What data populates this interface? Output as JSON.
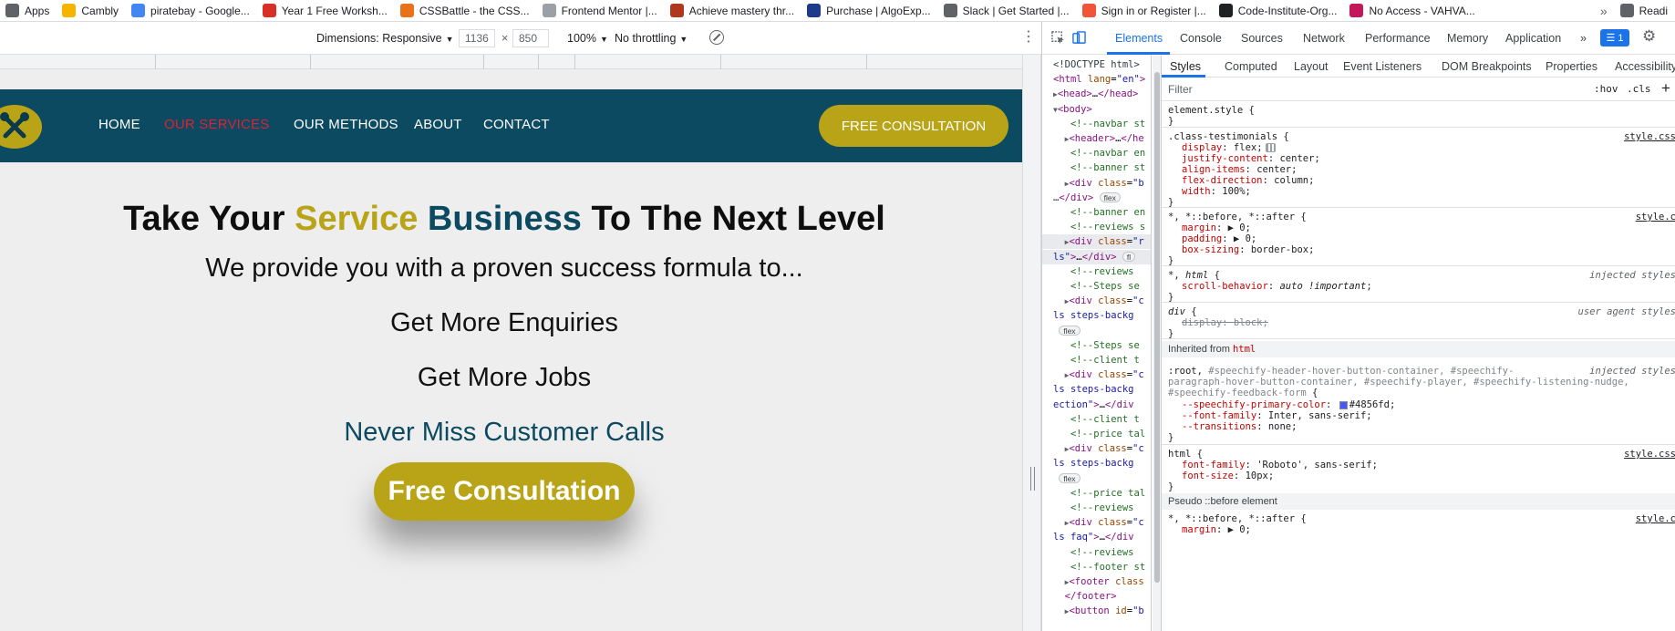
{
  "bookmarks": {
    "items": [
      {
        "label": "Apps",
        "icon": "apps-grid-icon",
        "color": "#5f6368"
      },
      {
        "label": "Cambly",
        "icon": "cambly-icon",
        "color": "#f4b400"
      },
      {
        "label": "piratebay - Google...",
        "icon": "google-icon",
        "color": "#4285f4"
      },
      {
        "label": "Year 1 Free Worksh...",
        "icon": "flag-icon",
        "color": "#d93025"
      },
      {
        "label": "CSSBattle - the CSS...",
        "icon": "cssbattle-icon",
        "color": "#e8711a"
      },
      {
        "label": "Frontend Mentor |...",
        "icon": "blank-page-icon",
        "color": "#9aa0a6"
      },
      {
        "label": "Achieve mastery thr...",
        "icon": "codewars-icon",
        "color": "#b1361e"
      },
      {
        "label": "Purchase | AlgoExp...",
        "icon": "algoexpert-icon",
        "color": "#1e3a8a"
      },
      {
        "label": "Slack | Get Started |...",
        "icon": "globe-icon",
        "color": "#5f6368"
      },
      {
        "label": "Sign in or Register |...",
        "icon": "eventbrite-icon",
        "color": "#f05537"
      },
      {
        "label": "Code-Institute-Org...",
        "icon": "github-icon",
        "color": "#202124"
      },
      {
        "label": "No Access - VAHVA...",
        "icon": "vahva-icon",
        "color": "#c2185b"
      }
    ],
    "more": "»",
    "trailing_label": "Readi"
  },
  "device_toolbar": {
    "dimensions_label": "Dimensions: Responsive",
    "width": "1136",
    "times": "×",
    "height": "850",
    "zoom": "100%",
    "throttling": "No throttling"
  },
  "site": {
    "nav": {
      "links": [
        "HOME",
        "OUR SERVICES",
        "OUR METHODS",
        "ABOUT",
        "CONTACT"
      ],
      "active_index": 1,
      "cta": "FREE CONSULTATION"
    },
    "hero": {
      "title_part1": "Take Your ",
      "title_gold": "Service",
      "title_space": " ",
      "title_teal": "Business",
      "title_part2": " To The Next Level",
      "subtitle": "We provide you with a proven success formula to...",
      "points": [
        "Get More Enquiries",
        "Get More Jobs",
        "Never Miss Customer Calls"
      ],
      "cta": "Free Consultation"
    },
    "colors": {
      "navbar": "#0b4a60",
      "accent_gold": "#b9a418",
      "active_link": "#e21f35",
      "background": "#eeeeee"
    }
  },
  "devtools": {
    "tabs": [
      "Elements",
      "Console",
      "Sources",
      "Network",
      "Performance",
      "Memory",
      "Application"
    ],
    "active_tab": "Elements",
    "more_tabs": "»",
    "issues_badge": "1",
    "dom_lines": [
      {
        "html": "<span class=\"txt\">&lt;!DOCTYPE html&gt;</span>"
      },
      {
        "html": "<span class=\"tag\">&lt;html</span> <span class=\"attr\">lang</span>=<span class=\"aval\">\"en\"</span><span class=\"tag\">&gt;</span>"
      },
      {
        "html": "<span class=\"tri\">▶</span><span class=\"tag\">&lt;head&gt;</span>…<span class=\"tag\">&lt;/head&gt;</span>"
      },
      {
        "html": "<span class=\"tri\">▼</span><span class=\"tag\">&lt;body&gt;</span>"
      },
      {
        "html": "&nbsp;&nbsp;&nbsp;<span class=\"cmt\">&lt;!--navbar st</span>"
      },
      {
        "html": "&nbsp;&nbsp;<span class=\"tri\">▶</span><span class=\"tag\">&lt;header&gt;</span>…<span class=\"tag\">&lt;/he</span>"
      },
      {
        "html": "&nbsp;&nbsp;&nbsp;<span class=\"cmt\">&lt;!--navbar en</span>"
      },
      {
        "html": "&nbsp;&nbsp;&nbsp;<span class=\"cmt\">&lt;!--banner st</span>"
      },
      {
        "html": "&nbsp;&nbsp;<span class=\"tri\">▶</span><span class=\"tag\">&lt;div</span> <span class=\"attr\">class</span>=<span class=\"aval\">\"b</span>"
      },
      {
        "html": "<span class=\"txt\">…</span><span class=\"tag\">&lt;/div&gt;</span> <span class=\"pill\">flex</span>"
      },
      {
        "html": "&nbsp;&nbsp;&nbsp;<span class=\"cmt\">&lt;!--banner en</span>"
      },
      {
        "html": "&nbsp;&nbsp;&nbsp;<span class=\"cmt\">&lt;!--reviews s</span>"
      },
      {
        "html": "&nbsp;&nbsp;<span class=\"tri\">▶</span><span class=\"tag\">&lt;div</span> <span class=\"attr\">class</span>=<span class=\"aval\">\"r</span>",
        "selected": true
      },
      {
        "html": "<span class=\"aval\">ls\"</span><span class=\"tag\">&gt;</span>…<span class=\"tag\">&lt;/div&gt;</span> <span class=\"pill\">fl</span>",
        "selected": true
      },
      {
        "html": "&nbsp;&nbsp;&nbsp;<span class=\"cmt\">&lt;!--reviews</span>"
      },
      {
        "html": "&nbsp;&nbsp;&nbsp;<span class=\"cmt\">&lt;!--Steps se</span>"
      },
      {
        "html": "&nbsp;&nbsp;<span class=\"tri\">▶</span><span class=\"tag\">&lt;div</span> <span class=\"attr\">class</span>=<span class=\"aval\">\"c</span>"
      },
      {
        "html": "<span class=\"aval\">ls steps-backg</span>"
      },
      {
        "html": "&nbsp;<span class=\"pill\">flex</span>"
      },
      {
        "html": "&nbsp;&nbsp;&nbsp;<span class=\"cmt\">&lt;!--Steps se</span>"
      },
      {
        "html": "&nbsp;&nbsp;&nbsp;<span class=\"cmt\">&lt;!--client t</span>"
      },
      {
        "html": "&nbsp;&nbsp;<span class=\"tri\">▶</span><span class=\"tag\">&lt;div</span> <span class=\"attr\">class</span>=<span class=\"aval\">\"c</span>"
      },
      {
        "html": "<span class=\"aval\">ls steps-backg</span>"
      },
      {
        "html": "<span class=\"aval\">ection\"</span><span class=\"tag\">&gt;</span>…<span class=\"tag\">&lt;/div</span>"
      },
      {
        "html": "&nbsp;&nbsp;&nbsp;<span class=\"cmt\">&lt;!--client t</span>"
      },
      {
        "html": "&nbsp;&nbsp;&nbsp;<span class=\"cmt\">&lt;!--price tal</span>"
      },
      {
        "html": "&nbsp;&nbsp;<span class=\"tri\">▶</span><span class=\"tag\">&lt;div</span> <span class=\"attr\">class</span>=<span class=\"aval\">\"c</span>"
      },
      {
        "html": "<span class=\"aval\">ls steps-backg</span>"
      },
      {
        "html": "&nbsp;<span class=\"pill\">flex</span>"
      },
      {
        "html": "&nbsp;&nbsp;&nbsp;<span class=\"cmt\">&lt;!--price tal</span>"
      },
      {
        "html": "&nbsp;&nbsp;&nbsp;<span class=\"cmt\">&lt;!--reviews</span>"
      },
      {
        "html": "&nbsp;&nbsp;<span class=\"tri\">▶</span><span class=\"tag\">&lt;div</span> <span class=\"attr\">class</span>=<span class=\"aval\">\"c</span>"
      },
      {
        "html": "<span class=\"aval\">ls faq\"</span><span class=\"tag\">&gt;</span>…<span class=\"tag\">&lt;/div</span>"
      },
      {
        "html": "&nbsp;&nbsp;&nbsp;<span class=\"cmt\">&lt;!--reviews</span>"
      },
      {
        "html": "&nbsp;&nbsp;&nbsp;<span class=\"cmt\">&lt;!--footer st</span>"
      },
      {
        "html": "&nbsp;&nbsp;<span class=\"tri\">▶</span><span class=\"tag\">&lt;footer</span> <span class=\"attr\">class</span>"
      },
      {
        "html": "&nbsp;&nbsp;<span class=\"tag\">&lt;/footer&gt;</span>"
      },
      {
        "html": "&nbsp;&nbsp;<span class=\"tri\">▶</span><span class=\"tag\">&lt;button</span> <span class=\"attr\">id</span>=<span class=\"aval\">\"b</span>"
      }
    ],
    "styles_tabs": [
      "Styles",
      "Computed",
      "Layout",
      "Event Listeners",
      "DOM Breakpoints",
      "Properties",
      "Accessibility"
    ],
    "filter_placeholder": "Filter",
    "hov": ":hov",
    "cls": ".cls",
    "plus": "+",
    "inherited_label": "Inherited from",
    "inherited_tag": "html",
    "pseudo_label": "Pseudo ::before element",
    "rules_html": [
      "<span class=\"sel-text\">element.style</span> {",
      "}",
      "<span class=\"sel-text\">.class-testimonials</span> {",
      "<span class=\"prop\">display</span>: <span class=\"val\">flex;</span><span class=\"flexicon\"></span>",
      "<span class=\"prop\">justify-content</span>: <span class=\"val\">center;</span>",
      "<span class=\"prop\">align-items</span>: <span class=\"val\">center;</span>",
      "<span class=\"prop\">flex-direction</span>: <span class=\"val\">column;</span>",
      "<span class=\"prop\">width</span>: <span class=\"val\">100%;</span>",
      "}",
      "<span class=\"sel-text\">*, *::before, *::after</span> {",
      "<span class=\"prop\">margin</span>: <span class=\"val\">▶ 0;</span>",
      "<span class=\"prop\">padding</span>: <span class=\"val\">▶ 0;</span>",
      "<span class=\"prop\">box-sizing</span>: <span class=\"val\">border-box;</span>",
      "}",
      "<span class=\"sel-text\">*, <i>html</i></span> {",
      "<span class=\"prop\">scroll-behavior</span>: <span class=\"val\"><i>auto !important</i>;</span>",
      "}",
      "<span class=\"sel-text\"><i>div</i></span> {",
      "<span class=\"strike\">display: block;</span>",
      "}",
      "<span class=\"sel-text\">:root, <span class=\"sel-dim\">#speechify-header-hover-button-container, #speechify-</span></span>",
      "<span class=\"sel-dim\">paragraph-hover-button-container, #speechify-player, #speechify-listening-nudge,</span>",
      "<span class=\"sel-dim\">#speechify-feedback-form</span> {",
      "<span class=\"prop var\">--speechify-primary-color</span>: <span class=\"swatch\"></span><span class=\"val\">#4856fd;</span>",
      "<span class=\"prop var\">--font-family</span>: <span class=\"val\">Inter, sans-serif;</span>",
      "<span class=\"prop var\">--transitions</span>: <span class=\"val\">none;</span>",
      "}",
      "<span class=\"sel-text\">html</span> {",
      "<span class=\"prop\">font-family</span>: <span class=\"val\">'Roboto', sans-serif;</span>",
      "<span class=\"prop\">font-size</span>: <span class=\"val\">10px;</span>",
      "}",
      "<span class=\"sel-text\">*, *::before, *::after</span> {",
      "<span class=\"prop\">margin</span>: <span class=\"val\">▶ 0;</span>"
    ],
    "rule_sources": [
      "style.css",
      "style.c",
      "injected styles",
      "user agent styles",
      "injected styles",
      "style.css",
      "style.c"
    ]
  }
}
